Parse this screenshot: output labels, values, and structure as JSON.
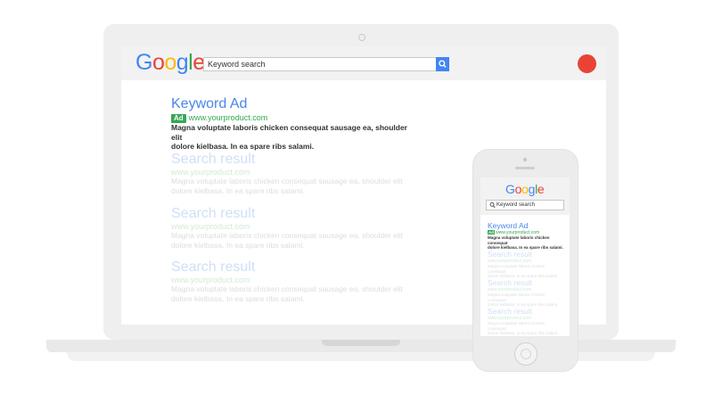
{
  "brand": {
    "logo_letters": [
      {
        "ch": "G",
        "color": "#4285f4"
      },
      {
        "ch": "o",
        "color": "#ea4335"
      },
      {
        "ch": "o",
        "color": "#fbbc05"
      },
      {
        "ch": "g",
        "color": "#4285f4"
      },
      {
        "ch": "l",
        "color": "#34a853"
      },
      {
        "ch": "e",
        "color": "#ea4335"
      }
    ]
  },
  "search": {
    "value": "Keyword search",
    "icon": "search-icon"
  },
  "results": {
    "ad": {
      "title": "Keyword Ad",
      "badge": "Ad",
      "url": "www.yourproduct.com",
      "snippet_line1": "Magna voluptate laboris chicken consequat sausage ea, shoulder elit",
      "snippet_line2": "dolore kielbasa. In ea spare ribs salami."
    },
    "organic": [
      {
        "title": "Search result",
        "url": "www.yourproduct.com",
        "snippet_line1": "Magna voluptate laboris chicken consequat sausage ea, shoulder elit",
        "snippet_line2": "dolore kielbasa. In ea spare ribs salami."
      },
      {
        "title": "Search result",
        "url": "www.yourproduct.com",
        "snippet_line1": "Magna voluptate laboris chicken consequat sausage ea, shoulder elit",
        "snippet_line2": "dolore kielbasa. In ea spare ribs salami."
      },
      {
        "title": "Search result",
        "url": "www.yourproduct.com",
        "snippet_line1": "Magna voluptate laboris chicken consequat sausage ea, shoulder elit",
        "snippet_line2": "dolore kielbasa. In ea spare ribs salami."
      }
    ]
  },
  "mobile": {
    "organic_snippet_line1": "Magna voluptate laboris chicken consequat",
    "organic_snippet_line2": "dolore kielbasa. In ea spare ribs salami.",
    "ad_snippet_line1": "Magna voluptate laboris chicken consequat",
    "ad_snippet_line2": "dolore kielbasa. In ea spare ribs salami."
  },
  "colors": {
    "ad_title": "#4a86e8",
    "ad_url": "#34a853",
    "search_button": "#4285f4",
    "avatar": "#ea4335"
  }
}
